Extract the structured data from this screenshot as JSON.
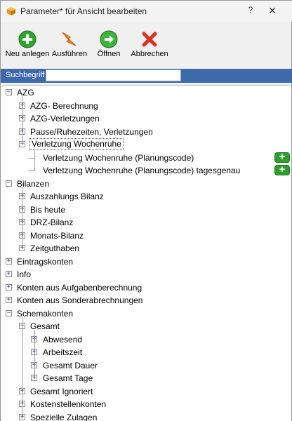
{
  "window": {
    "title": "Parameter* für Ansicht bearbeiten",
    "help_label": "?",
    "close_label": "✕"
  },
  "toolbar": {
    "new_label": "Neu anlegen",
    "execute_label": "Ausführen",
    "open_label": "Öffnen",
    "cancel_label": "Abbrechen"
  },
  "search": {
    "label": "Suchbegriff",
    "value": ""
  },
  "tree": [
    {
      "label": "AZG",
      "level": 0,
      "toggle": "−"
    },
    {
      "label": "AZG- Berechnung",
      "level": 1,
      "toggle": "+"
    },
    {
      "label": "AZG-Verletzungen",
      "level": 1,
      "toggle": "+"
    },
    {
      "label": "Pause/Ruhezeiten, Verletzungen",
      "level": 1,
      "toggle": "+"
    },
    {
      "label": "Verletzung Wochenruhe",
      "level": 1,
      "toggle": "−",
      "selected": true
    },
    {
      "label": "Verletzung Wochenruhe (Planungscode)",
      "level": 2,
      "toggle": "",
      "add": true
    },
    {
      "label": "Verletzung Wochenruhe (Planungscode) tagesgenau",
      "level": 2,
      "toggle": "",
      "add": true
    },
    {
      "label": "Bilanzen",
      "level": 0,
      "toggle": "−"
    },
    {
      "label": "Auszahlungs Bilanz",
      "level": 1,
      "toggle": "+"
    },
    {
      "label": "Bis heute",
      "level": 1,
      "toggle": "+"
    },
    {
      "label": "DRZ-Bilanz",
      "level": 1,
      "toggle": "+"
    },
    {
      "label": "Monats-Bilanz",
      "level": 1,
      "toggle": "+"
    },
    {
      "label": "Zeitguthaben",
      "level": 1,
      "toggle": "+"
    },
    {
      "label": "Eintragskonten",
      "level": 0,
      "toggle": "+"
    },
    {
      "label": "Info",
      "level": 0,
      "toggle": "+"
    },
    {
      "label": "Konten aus Aufgabenberechnung",
      "level": 0,
      "toggle": "+"
    },
    {
      "label": "Konten aus Sonderabrechnungen",
      "level": 0,
      "toggle": "+"
    },
    {
      "label": "Schemakonten",
      "level": 0,
      "toggle": "−"
    },
    {
      "label": "Gesamt",
      "level": 1,
      "toggle": "−"
    },
    {
      "label": "Abwesend",
      "level": 2,
      "toggle": "+"
    },
    {
      "label": "Arbeitszeit",
      "level": 2,
      "toggle": "+"
    },
    {
      "label": "Gesamt Dauer",
      "level": 2,
      "toggle": "+"
    },
    {
      "label": "Gesamt Tage",
      "level": 2,
      "toggle": "+"
    },
    {
      "label": "Gesamt Ignoriert",
      "level": 1,
      "toggle": "+"
    },
    {
      "label": "Kostenstellenkonten",
      "level": 1,
      "toggle": "+"
    },
    {
      "label": "Spezielle Zulagen",
      "level": 1,
      "toggle": "+"
    }
  ],
  "colors": {
    "search_bar": "#3d69ad",
    "add_button": "#2ba02b"
  },
  "icons": {
    "app": "cube-icon",
    "new": "plus-circle-icon",
    "execute": "lightning-icon",
    "open": "arrow-right-circle-icon",
    "cancel": "red-x-icon",
    "add_row": "plus-icon"
  }
}
